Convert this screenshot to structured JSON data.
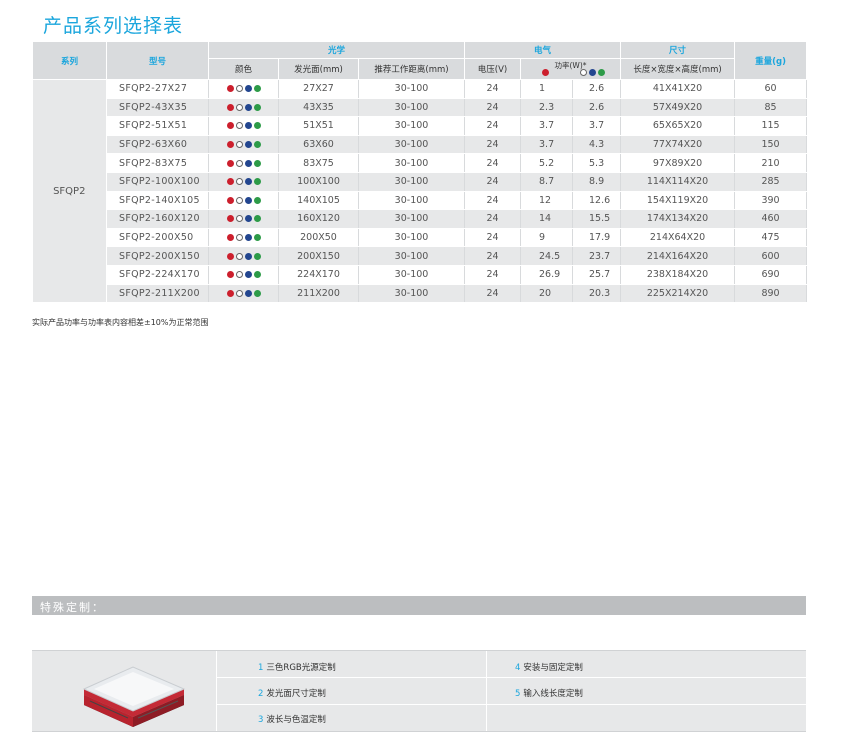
{
  "page_title": "产品系列选择表",
  "table": {
    "headers": {
      "series": "系列",
      "model": "型号",
      "optics": "光学",
      "electrical": "电气",
      "size": "尺寸",
      "weight": "重量(g)",
      "color": "颜色",
      "emit_area": "发光面(mm)",
      "work_distance": "推荐工作距离(mm)",
      "voltage": "电压(V)",
      "power": "功率(W)*",
      "dimensions": "长度×宽度×高度(mm)"
    },
    "series_name": "SFQP2",
    "color_dots": [
      "red",
      "white",
      "blue",
      "green"
    ],
    "rows": [
      {
        "model": "SFQP2-27X27",
        "area": "27X27",
        "distance": "30-100",
        "voltage": "24",
        "power_r": "1",
        "power_wbg": "2.6",
        "dims": "41X41X20",
        "weight": "60"
      },
      {
        "model": "SFQP2-43X35",
        "area": "43X35",
        "distance": "30-100",
        "voltage": "24",
        "power_r": "2.3",
        "power_wbg": "2.6",
        "dims": "57X49X20",
        "weight": "85"
      },
      {
        "model": "SFQP2-51X51",
        "area": "51X51",
        "distance": "30-100",
        "voltage": "24",
        "power_r": "3.7",
        "power_wbg": "3.7",
        "dims": "65X65X20",
        "weight": "115"
      },
      {
        "model": "SFQP2-63X60",
        "area": "63X60",
        "distance": "30-100",
        "voltage": "24",
        "power_r": "3.7",
        "power_wbg": "4.3",
        "dims": "77X74X20",
        "weight": "150"
      },
      {
        "model": "SFQP2-83X75",
        "area": "83X75",
        "distance": "30-100",
        "voltage": "24",
        "power_r": "5.2",
        "power_wbg": "5.3",
        "dims": "97X89X20",
        "weight": "210"
      },
      {
        "model": "SFQP2-100X100",
        "area": "100X100",
        "distance": "30-100",
        "voltage": "24",
        "power_r": "8.7",
        "power_wbg": "8.9",
        "dims": "114X114X20",
        "weight": "285"
      },
      {
        "model": "SFQP2-140X105",
        "area": "140X105",
        "distance": "30-100",
        "voltage": "24",
        "power_r": "12",
        "power_wbg": "12.6",
        "dims": "154X119X20",
        "weight": "390"
      },
      {
        "model": "SFQP2-160X120",
        "area": "160X120",
        "distance": "30-100",
        "voltage": "24",
        "power_r": "14",
        "power_wbg": "15.5",
        "dims": "174X134X20",
        "weight": "460"
      },
      {
        "model": "SFQP2-200X50",
        "area": "200X50",
        "distance": "30-100",
        "voltage": "24",
        "power_r": "9",
        "power_wbg": "17.9",
        "dims": "214X64X20",
        "weight": "475"
      },
      {
        "model": "SFQP2-200X150",
        "area": "200X150",
        "distance": "30-100",
        "voltage": "24",
        "power_r": "24.5",
        "power_wbg": "23.7",
        "dims": "214X164X20",
        "weight": "600"
      },
      {
        "model": "SFQP2-224X170",
        "area": "224X170",
        "distance": "30-100",
        "voltage": "24",
        "power_r": "26.9",
        "power_wbg": "25.7",
        "dims": "238X184X20",
        "weight": "690"
      },
      {
        "model": "SFQP2-211X200",
        "area": "211X200",
        "distance": "30-100",
        "voltage": "24",
        "power_r": "20",
        "power_wbg": "20.3",
        "dims": "225X214X20",
        "weight": "890"
      }
    ]
  },
  "note": "实际产品功率与功率表内容相差±10%为正常范围",
  "custom": {
    "title": "特殊定制：",
    "options": [
      {
        "num": "1",
        "text": "三色RGB光源定制"
      },
      {
        "num": "2",
        "text": "发光面尺寸定制"
      },
      {
        "num": "3",
        "text": "波长与色温定制"
      },
      {
        "num": "4",
        "text": "安装与固定定制"
      },
      {
        "num": "5",
        "text": "输入线长度定制"
      }
    ]
  },
  "colors": {
    "accent": "#1ba6dd",
    "header_bg": "#d9dbdd",
    "row_alt": "#e7e8e9",
    "dot_red": "#cc1f2d",
    "dot_blue": "#23468f",
    "dot_green": "#2d9b48"
  }
}
